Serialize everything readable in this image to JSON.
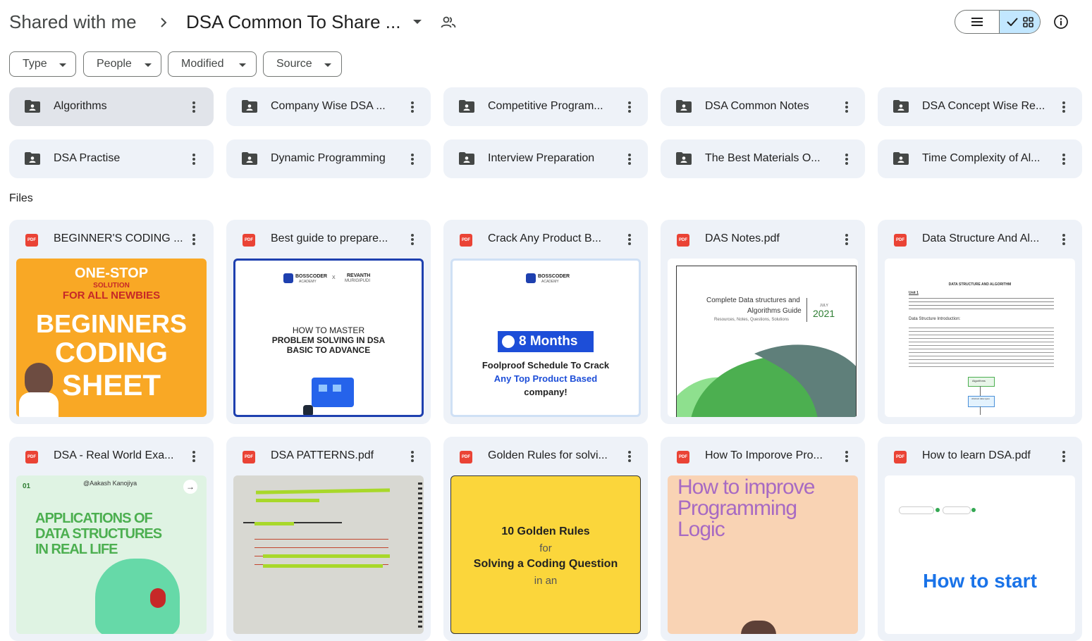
{
  "header": {
    "root": "Shared with me",
    "current": "DSA Common To Share ...",
    "icons": {
      "separator": "chevron-right-icon",
      "dropdown": "caret-down-icon",
      "shared": "people-icon",
      "list": "list-view-icon",
      "grid": "grid-view-icon",
      "check": "check-icon",
      "info": "info-icon"
    }
  },
  "filters": [
    {
      "label": "Type"
    },
    {
      "label": "People"
    },
    {
      "label": "Modified"
    },
    {
      "label": "Source"
    }
  ],
  "folders": [
    {
      "name": "Algorithms"
    },
    {
      "name": "Company Wise DSA ..."
    },
    {
      "name": "Competitive Program..."
    },
    {
      "name": "DSA Common Notes"
    },
    {
      "name": "DSA Concept Wise Re..."
    },
    {
      "name": "DSA Practise"
    },
    {
      "name": "Dynamic Programming"
    },
    {
      "name": "Interview Preparation"
    },
    {
      "name": "The Best Materials O..."
    },
    {
      "name": "Time Complexity of Al..."
    }
  ],
  "files_label": "Files",
  "pdf_badge": "PDF",
  "files": [
    {
      "name": "BEGINNER'S CODING ..."
    },
    {
      "name": "Best guide to prepare..."
    },
    {
      "name": "Crack Any Product B..."
    },
    {
      "name": "DAS Notes.pdf"
    },
    {
      "name": "Data Structure And Al..."
    },
    {
      "name": "DSA - Real World Exa..."
    },
    {
      "name": "DSA PATTERNS.pdf"
    },
    {
      "name": "Golden Rules for solvi..."
    },
    {
      "name": "How To Imporove Pro..."
    },
    {
      "name": "How to learn DSA.pdf"
    }
  ],
  "thumbs": {
    "t1": {
      "line1": "ONE-STOP",
      "line2": "SOLUTION",
      "line3": "FOR ALL NEWBIES",
      "line4": "BEGINNERS",
      "line5": "CODING",
      "line6": "SHEET"
    },
    "t2": {
      "brand": "BOSSCODER",
      "brand_sub": "ACADEMY",
      "x": "X",
      "partner": "REVANTH",
      "partner_sub": "MURIGIPUDI",
      "line1": "HOW TO MASTER",
      "line2": "PROBLEM SOLVING IN DSA",
      "line3": "BASIC TO ADVANCE"
    },
    "t3": {
      "brand": "BOSSCODER",
      "brand_sub": "ACADEMY",
      "badge": "8 Months",
      "line1": "Foolproof Schedule To Crack",
      "line2": "Any Top Product Based",
      "line3": "company!"
    },
    "t4": {
      "line1": "Complete Data structures and",
      "line2": "Algorithms Guide",
      "line3": "Resources, Notes, Questions, Solutions",
      "month": "JULY",
      "year": "2021"
    },
    "t5": {
      "title": "DATA STRUCTURE AND ALGORITHM",
      "unit": "Unit 1",
      "intro": "Data Structure Introduction:",
      "box1": "Algorithms",
      "box2": "Abstract data types"
    },
    "t6": {
      "num": "01",
      "author": "@Aakash Kanojiya",
      "line1": "APPLICATIONS OF",
      "line2": "DATA STRUCTURES",
      "line3": "IN REAL LIFE"
    },
    "t8": {
      "line1": "10 Golden Rules",
      "line2": "for",
      "line3": "Solving a Coding Question",
      "line4": "in an"
    },
    "t9": {
      "line1": "How to improve",
      "line2": "Programming",
      "line3": "Logic"
    },
    "t10": {
      "line1": "How to start"
    }
  }
}
